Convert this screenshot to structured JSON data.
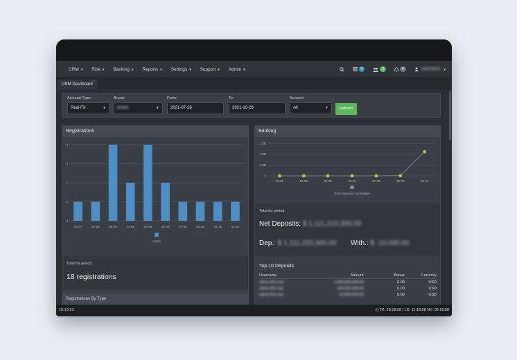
{
  "navbar": {
    "items": [
      {
        "label": "CRM"
      },
      {
        "label": "Risk"
      },
      {
        "label": "Banking"
      },
      {
        "label": "Reports"
      },
      {
        "label": "Settings"
      },
      {
        "label": "Support"
      },
      {
        "label": "Admin"
      }
    ],
    "list_badge": "0",
    "users_badge": "2",
    "bell_badge": "0",
    "username": "username",
    "colors": {
      "list_badge": "#3b8fc4",
      "users_badge": "#5cb85c",
      "bell_badge": "#6c757d"
    }
  },
  "tab": {
    "label": "CRM Dashboard",
    "close": "×"
  },
  "filters": {
    "account_type": {
      "label": "Account Type:",
      "value": "Real FX"
    },
    "brand": {
      "label": "Brand:",
      "value": "Brand"
    },
    "from": {
      "label": "From:",
      "value": "2021-07-28"
    },
    "to": {
      "label": "To:",
      "value": "2021-10-28"
    },
    "account": {
      "label": "Account:",
      "value": "All"
    },
    "refresh_label": "Refresh"
  },
  "registrations": {
    "title": "Registrations",
    "legend": "Users",
    "period_label": "Total for period",
    "total": "18 registrations",
    "next_panel_title": "Registrations By Type"
  },
  "banking": {
    "title": "Banking",
    "legend": "Total Deposits Cumulative",
    "period_label": "Total for period",
    "net_label": "Net Deposits:",
    "net_value": "$ 1,111,210,300.00",
    "dep_label": "Dep.:",
    "dep_value": "$ 1,111,220,300.00",
    "with_label": "With.:",
    "with_value": "$ -10,000.00"
  },
  "top_deposits": {
    "title": "Top 10 Deposits",
    "headers": [
      "Username",
      "Amount",
      "Bonus",
      "Currency"
    ],
    "rows": [
      {
        "username": "client-001-real",
        "amount": "1,000,000,000.00",
        "bonus": "0.00",
        "currency": "USD"
      },
      {
        "username": "client-002-real",
        "amount": "100,000,000.00",
        "bonus": "0.00",
        "currency": "USD"
      },
      {
        "username": "client-003-real",
        "amount": "10,000,000.00",
        "bonus": "0.00",
        "currency": "USD"
      }
    ]
  },
  "status": {
    "time": "10:10:13",
    "clocks": "TK: 18:18:58 | LD: 11:18:58 NY: 06:18:58"
  },
  "chart_data": [
    {
      "type": "bar",
      "categories": [
        "30-07",
        "04-08",
        "09-08",
        "13-08",
        "18-08",
        "19-08",
        "07-09",
        "20-09",
        "04-10",
        "13-10"
      ],
      "y_ticks": [
        "0",
        "1",
        "2",
        "3",
        "4"
      ],
      "ylim": [
        0,
        4
      ],
      "series": [
        {
          "name": "Users",
          "values": [
            1,
            1,
            4,
            2,
            4,
            2,
            1,
            1,
            1,
            1
          ],
          "color": "#4d8fc4"
        }
      ]
    },
    {
      "type": "line",
      "categories": [
        "06-08",
        "18-08",
        "02-09",
        "06-09",
        "07-09",
        "29-09",
        "04-10"
      ],
      "y_ticks": [
        "0",
        "0.5B",
        "1.0B",
        "1.5B"
      ],
      "ylim": [
        0,
        1.5
      ],
      "series": [
        {
          "name": "Total Deposits Cumulative",
          "values": [
            0,
            0,
            0,
            0,
            0,
            0.01,
            1.11
          ],
          "color": "#a8d455"
        }
      ]
    }
  ]
}
